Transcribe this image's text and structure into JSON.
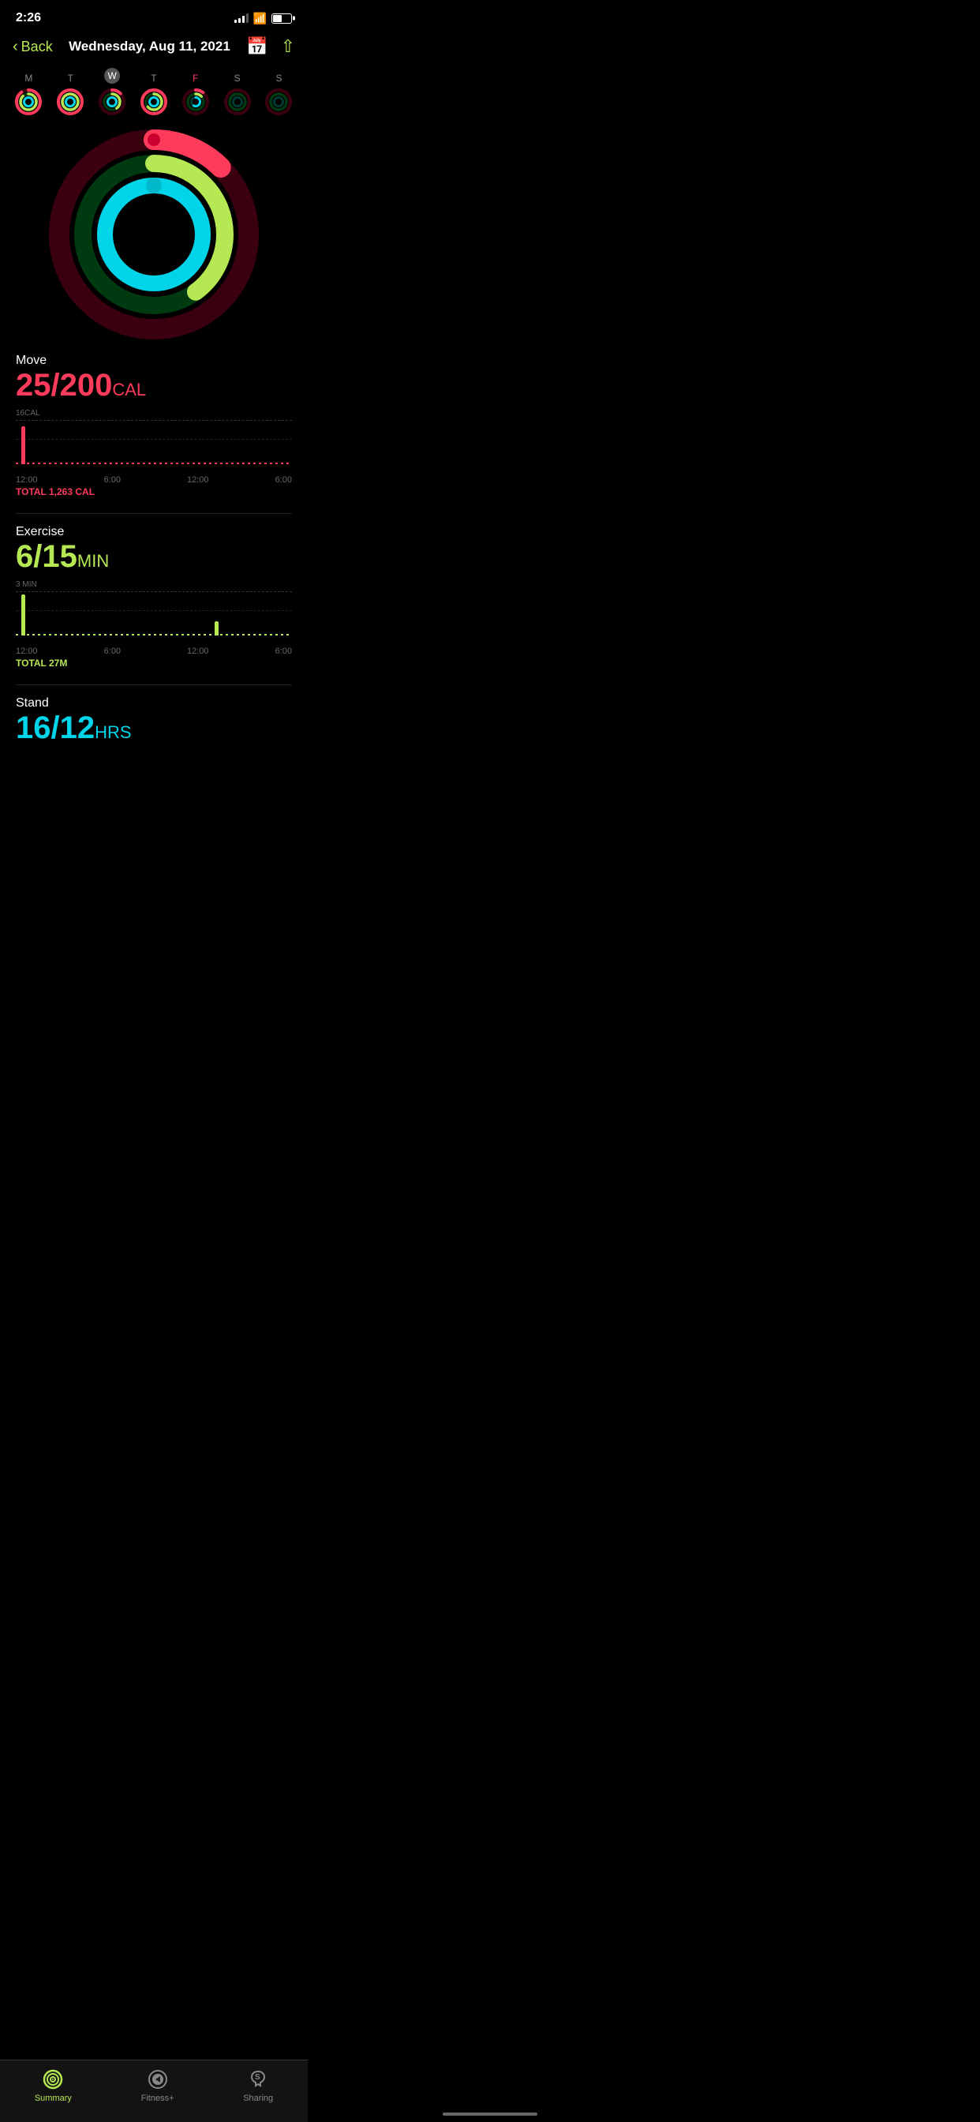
{
  "statusBar": {
    "time": "2:26",
    "locationIcon": "↑"
  },
  "nav": {
    "backLabel": "Back",
    "title": "Wednesday, Aug 11, 2021",
    "calendarIcon": "calendar-icon",
    "shareIcon": "share-icon"
  },
  "weekDays": [
    {
      "label": "M",
      "active": false,
      "red": false
    },
    {
      "label": "T",
      "active": false,
      "red": false
    },
    {
      "label": "W",
      "active": true,
      "red": false
    },
    {
      "label": "T",
      "active": false,
      "red": false
    },
    {
      "label": "F",
      "active": false,
      "red": true
    },
    {
      "label": "S",
      "active": false,
      "red": false
    },
    {
      "label": "S",
      "active": false,
      "red": false
    }
  ],
  "activityRings": {
    "moveProgress": 0.125,
    "exerciseProgress": 0.4,
    "standProgress": 1.33
  },
  "move": {
    "label": "Move",
    "current": "25",
    "goal": "200",
    "unit": "CAL",
    "color": "#ff3b5c",
    "chartYLabel": "16CAL",
    "chartTotal": "TOTAL 1,263 CAL",
    "xLabels": [
      "12:00",
      "6:00",
      "12:00",
      "6:00"
    ]
  },
  "exercise": {
    "label": "Exercise",
    "current": "6",
    "goal": "15",
    "unit": "MIN",
    "color": "#b5e853",
    "chartYLabel": "3 MIN",
    "chartTotal": "TOTAL 27M",
    "xLabels": [
      "12:00",
      "6:00",
      "12:00",
      "6:00"
    ]
  },
  "stand": {
    "label": "Stand",
    "current": "16",
    "goal": "12",
    "unit": "HRS",
    "color": "#00d4e8"
  },
  "tabBar": {
    "tabs": [
      {
        "label": "Summary",
        "active": true
      },
      {
        "label": "Fitness+",
        "active": false
      },
      {
        "label": "Sharing",
        "active": false
      }
    ]
  }
}
